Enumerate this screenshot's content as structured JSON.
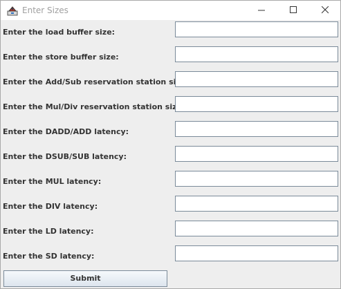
{
  "window": {
    "title": "Enter Sizes",
    "icons": {
      "app": "java-app-icon",
      "minimize": "minimize-icon",
      "maximize": "maximize-icon",
      "close": "close-icon"
    }
  },
  "form": {
    "fields": [
      {
        "label": "Enter the load buffer size:",
        "value": ""
      },
      {
        "label": "Enter the store buffer size:",
        "value": ""
      },
      {
        "label": "Enter the Add/Sub reservation station size:",
        "value": ""
      },
      {
        "label": "Enter the Mul/Div reservation station size:",
        "value": ""
      },
      {
        "label": "Enter the DADD/ADD latency:",
        "value": ""
      },
      {
        "label": "Enter the DSUB/SUB latency:",
        "value": ""
      },
      {
        "label": "Enter the MUL latency:",
        "value": ""
      },
      {
        "label": "Enter the DIV latency:",
        "value": ""
      },
      {
        "label": "Enter the LD latency:",
        "value": ""
      },
      {
        "label": "Enter the SD latency:",
        "value": ""
      }
    ],
    "submit_label": "Submit"
  },
  "colors": {
    "content_background": "#eeeeee",
    "field_border": "#7a8a99",
    "label_text": "#333333",
    "title_text": "#a0a0a0"
  }
}
